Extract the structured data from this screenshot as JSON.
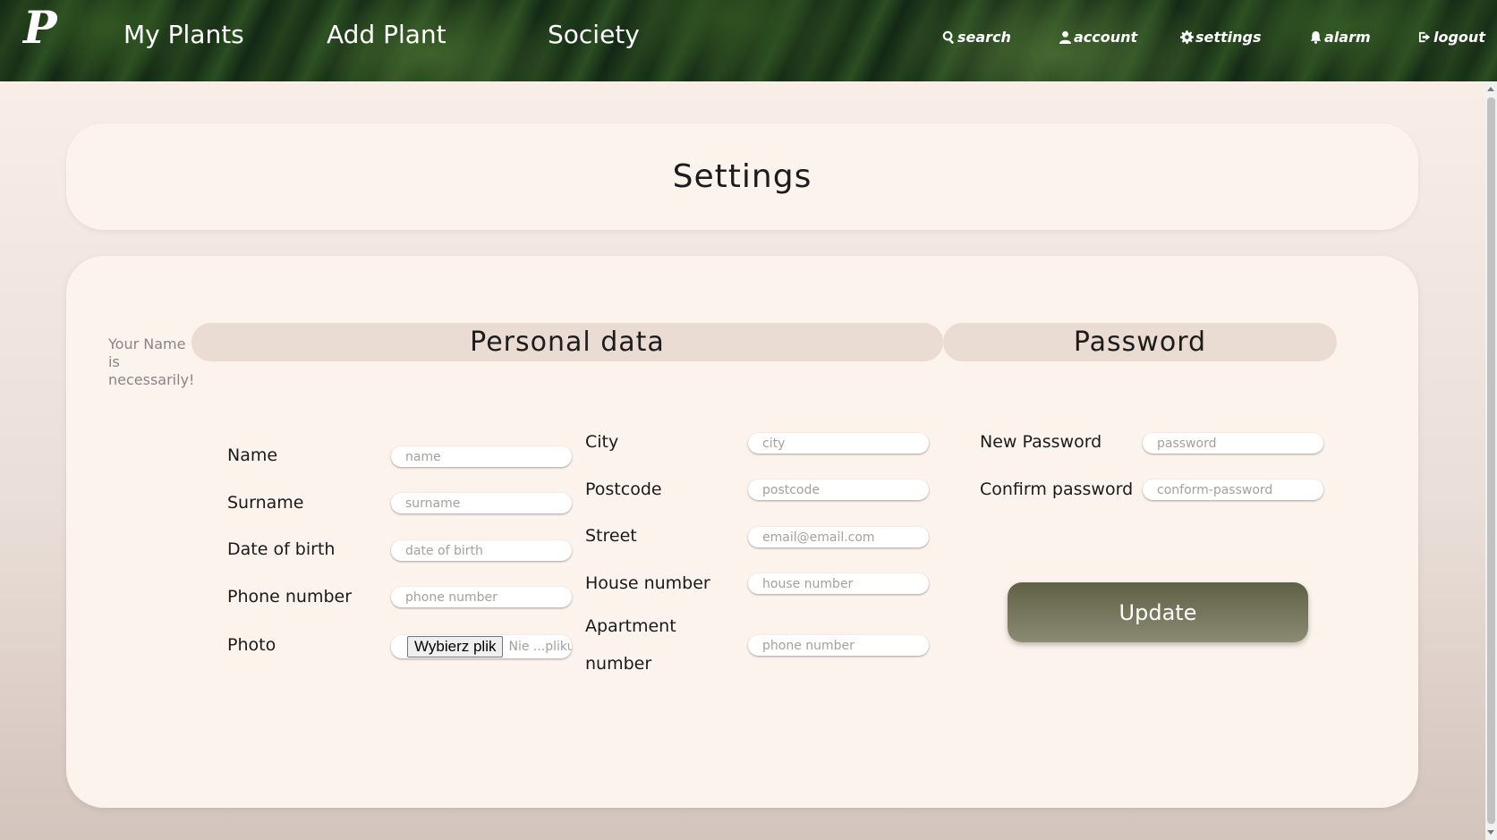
{
  "header": {
    "logo": "P",
    "nav": {
      "my_plants": "My Plants",
      "add_plant": "Add Plant",
      "society": "Society"
    },
    "actions": {
      "search": "search",
      "account": "account",
      "settings": "settings",
      "alarm": "alarm",
      "logout": "logout"
    }
  },
  "page": {
    "title": "Settings",
    "hint": "Your Name is necessarily!"
  },
  "sections": {
    "personal": "Personal data",
    "password": "Password"
  },
  "personal_fields": {
    "name": {
      "label": "Name",
      "placeholder": "name",
      "value": ""
    },
    "surname": {
      "label": "Surname",
      "placeholder": "surname",
      "value": ""
    },
    "dob": {
      "label": "Date of birth",
      "placeholder": "date of birth",
      "value": ""
    },
    "phone": {
      "label": "Phone number",
      "placeholder": "phone number",
      "value": ""
    },
    "photo": {
      "label": "Photo",
      "button": "Wybierz plik",
      "status": "Nie ...pliku"
    }
  },
  "address_fields": {
    "city": {
      "label": "City",
      "placeholder": "city",
      "value": ""
    },
    "postcode": {
      "label": "Postcode",
      "placeholder": "postcode",
      "value": ""
    },
    "street": {
      "label": "Street",
      "placeholder": "email@email.com",
      "value": ""
    },
    "house": {
      "label": "House number",
      "placeholder": "house number",
      "value": ""
    },
    "apartment": {
      "label": "Apartment number",
      "placeholder": "phone number",
      "value": ""
    }
  },
  "password_fields": {
    "new": {
      "label": "New Password",
      "placeholder": "password",
      "value": ""
    },
    "confirm": {
      "label": "Confirm password",
      "placeholder": "conform-password",
      "value": ""
    }
  },
  "update_button": "Update",
  "icons": {
    "search": "search-icon",
    "account": "user-icon",
    "settings": "gear-icon",
    "alarm": "bell-icon",
    "logout": "logout-icon"
  },
  "colors": {
    "background": "#fcf1ea",
    "card": "#fdf3ed",
    "section_bar": "#eadbd3",
    "button": "#6f715a"
  }
}
